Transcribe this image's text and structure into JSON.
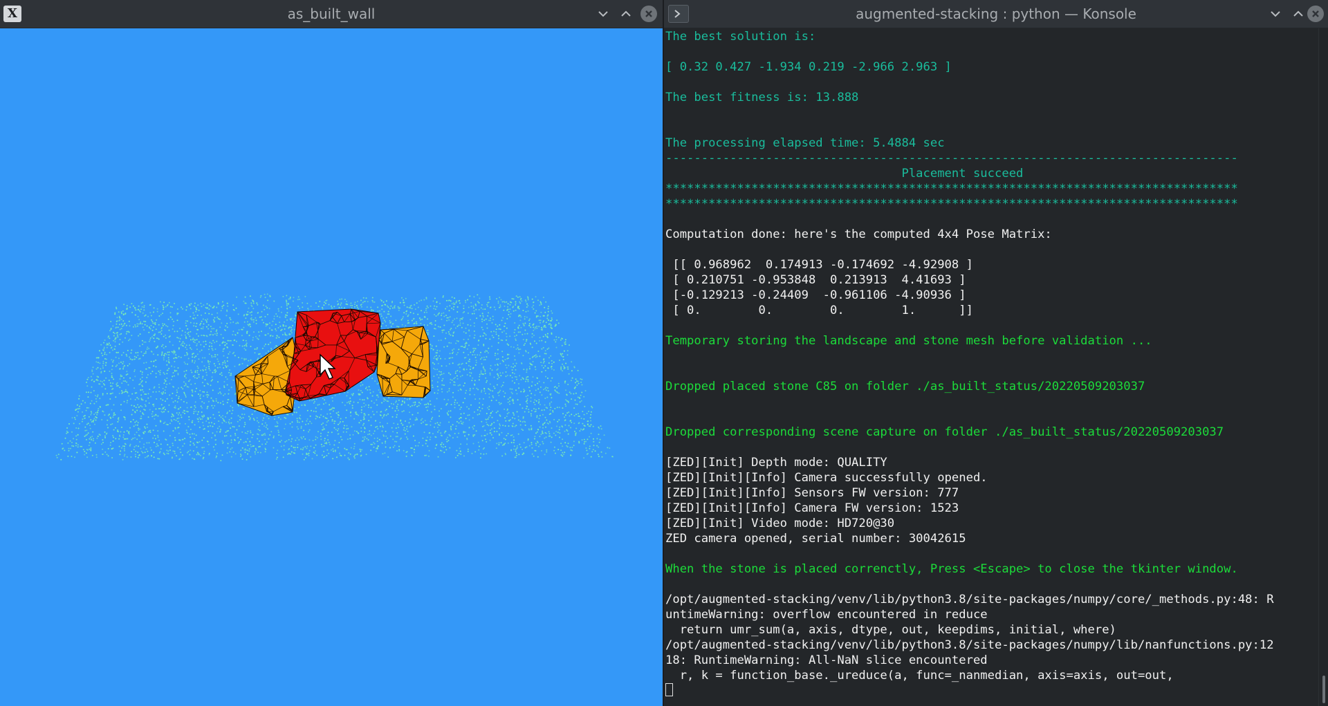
{
  "left_window": {
    "title": "as_built_wall",
    "app_icon_glyph": "X",
    "background_color": "#3498f8",
    "point_color": "#7ff0b0",
    "stone_colors": {
      "selected": "#e81010",
      "placed": "#f5a80a"
    }
  },
  "right_window": {
    "title": "augmented-stacking : python — Konsole",
    "lines": [
      {
        "text": "The best solution is:",
        "color": "teal"
      },
      {
        "text": "",
        "color": "teal"
      },
      {
        "text": "[ 0.32 0.427 -1.934 0.219 -2.966 2.963 ]",
        "color": "teal"
      },
      {
        "text": "",
        "color": "teal"
      },
      {
        "text": "The best fitness is: 13.888",
        "color": "teal"
      },
      {
        "text": "",
        "color": "teal"
      },
      {
        "text": "",
        "color": "teal"
      },
      {
        "text": "The processing elapsed time: 5.4884 sec",
        "color": "teal"
      },
      {
        "text": "--------------------------------------------------------------------------------",
        "color": "teal"
      },
      {
        "text": "                                 Placement succeed",
        "color": "teal"
      },
      {
        "text": "********************************************************************************",
        "color": "teal"
      },
      {
        "text": "********************************************************************************",
        "color": "teal"
      },
      {
        "text": "",
        "color": "white"
      },
      {
        "text": "Computation done: here's the computed 4x4 Pose Matrix:",
        "color": "white"
      },
      {
        "text": "",
        "color": "white"
      },
      {
        "text": " [[ 0.968962  0.174913 -0.174692 -4.92908 ]",
        "color": "white"
      },
      {
        "text": " [ 0.210751 -0.953848  0.213913  4.41693 ]",
        "color": "white"
      },
      {
        "text": " [-0.129213 -0.24409  -0.961106 -4.90936 ]",
        "color": "white"
      },
      {
        "text": " [ 0.        0.        0.        1.      ]]",
        "color": "white"
      },
      {
        "text": "",
        "color": "white"
      },
      {
        "text": "Temporary storing the landscape and stone mesh before validation ...",
        "color": "green"
      },
      {
        "text": "",
        "color": "green"
      },
      {
        "text": "",
        "color": "green"
      },
      {
        "text": "Dropped placed stone C85 on folder ./as_built_status/20220509203037",
        "color": "green"
      },
      {
        "text": "",
        "color": "green"
      },
      {
        "text": "",
        "color": "green"
      },
      {
        "text": "Dropped corresponding scene capture on folder ./as_built_status/20220509203037",
        "color": "green"
      },
      {
        "text": "",
        "color": "white"
      },
      {
        "text": "[ZED][Init] Depth mode: QUALITY",
        "color": "white"
      },
      {
        "text": "[ZED][Init][Info] Camera successfully opened.",
        "color": "white"
      },
      {
        "text": "[ZED][Init][Info] Sensors FW version: 777",
        "color": "white"
      },
      {
        "text": "[ZED][Init][Info] Camera FW version: 1523",
        "color": "white"
      },
      {
        "text": "[ZED][Init] Video mode: HD720@30",
        "color": "white"
      },
      {
        "text": "ZED camera opened, serial number: 30042615",
        "color": "white"
      },
      {
        "text": "",
        "color": "white"
      },
      {
        "text": "When the stone is placed correnctly, Press <Escape> to close the tkinter window.",
        "color": "green"
      },
      {
        "text": "",
        "color": "white"
      },
      {
        "text": "/opt/augmented-stacking/venv/lib/python3.8/site-packages/numpy/core/_methods.py:48: R",
        "color": "white"
      },
      {
        "text": "untimeWarning: overflow encountered in reduce",
        "color": "white"
      },
      {
        "text": "  return umr_sum(a, axis, dtype, out, keepdims, initial, where)",
        "color": "white"
      },
      {
        "text": "/opt/augmented-stacking/venv/lib/python3.8/site-packages/numpy/lib/nanfunctions.py:12",
        "color": "white"
      },
      {
        "text": "18: RuntimeWarning: All-NaN slice encountered",
        "color": "white"
      },
      {
        "text": "  r, k = function_base._ureduce(a, func=_nanmedian, axis=axis, out=out,",
        "color": "white"
      }
    ]
  },
  "icons": {
    "left_app": "x11-app-icon",
    "right_app": "konsole-icon",
    "controls": [
      "minimize-icon",
      "maximize-icon",
      "close-icon"
    ]
  }
}
